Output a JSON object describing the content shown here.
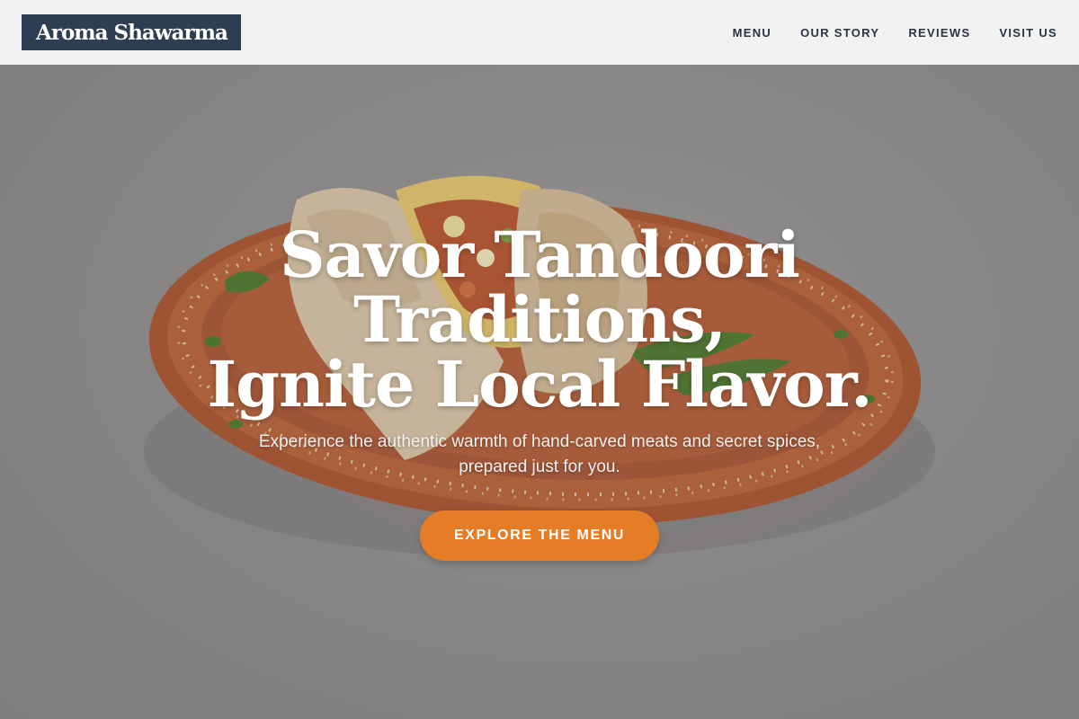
{
  "header": {
    "logo_text": "Aroma Shawarma",
    "nav": [
      {
        "label": "MENU"
      },
      {
        "label": "OUR STORY"
      },
      {
        "label": "REVIEWS"
      },
      {
        "label": "VISIT US"
      }
    ]
  },
  "hero": {
    "title_line1": "Savor Tandoori Traditions,",
    "title_line2": "Ignite Local Flavor.",
    "subtitle": "Experience the authentic warmth of hand-carved meats and secret spices, prepared just for you.",
    "cta_label": "EXPLORE THE MENU",
    "image_subject": "shawarma wrap on terracotta plate"
  },
  "colors": {
    "logo_background": "#2d3e52",
    "accent": "#e57c26",
    "nav_text": "#2a3442",
    "header_background": "#f6f6f6",
    "plate": "#b5582f"
  }
}
